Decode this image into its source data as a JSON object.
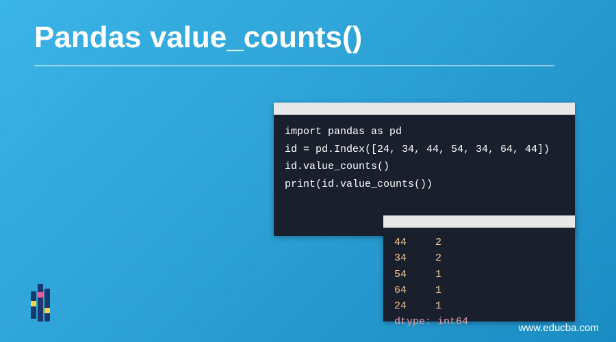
{
  "title": "Pandas value_counts()",
  "code": {
    "line1": "import pandas as pd",
    "line2": "id = pd.Index([24, 34, 44, 54, 34, 64, 44])",
    "line3": "id.value_counts()",
    "line4": "print(id.value_counts())"
  },
  "output": {
    "rows": [
      {
        "key": "44",
        "val": "2"
      },
      {
        "key": "34",
        "val": "2"
      },
      {
        "key": "54",
        "val": "1"
      },
      {
        "key": "64",
        "val": "1"
      },
      {
        "key": "24",
        "val": "1"
      }
    ],
    "dtype": "dtype: int64"
  },
  "website": "www.educba.com"
}
